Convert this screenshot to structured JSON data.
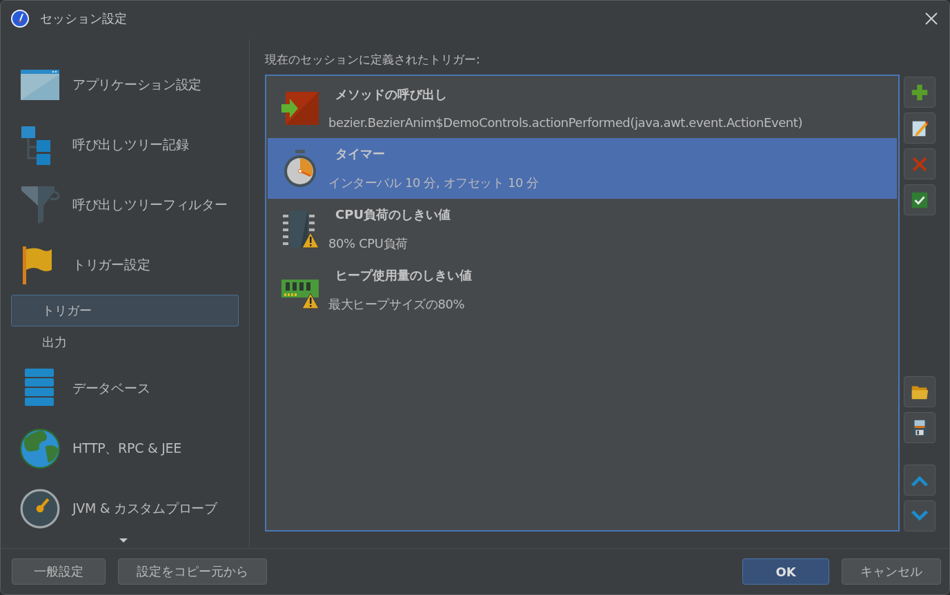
{
  "window": {
    "title": "セッション設定"
  },
  "sidebar": {
    "items": [
      {
        "label": "アプリケーション設定",
        "selected": false
      },
      {
        "label": "呼び出しツリー記録",
        "selected": false
      },
      {
        "label": "呼び出しツリーフィルター",
        "selected": false
      },
      {
        "label": "トリガー設定",
        "selected": false,
        "children": [
          {
            "label": "トリガー",
            "selected": true
          },
          {
            "label": "出力",
            "selected": false
          }
        ]
      },
      {
        "label": "データベース",
        "selected": false
      },
      {
        "label": "HTTP、RPC & JEE",
        "selected": false
      },
      {
        "label": "JVM & カスタムプローブ",
        "selected": false
      }
    ]
  },
  "triggers": {
    "heading": "現在のセッションに定義されたトリガー:",
    "items": [
      {
        "title": "メソッドの呼び出し",
        "detail": "bezier.BezierAnim$DemoControls.actionPerformed(java.awt.event.ActionEvent)",
        "selected": false
      },
      {
        "title": "タイマー",
        "detail": "インターバル 10 分, オフセット 10 分",
        "selected": true
      },
      {
        "title": "CPU負荷のしきい値",
        "detail": "80% CPU負荷",
        "selected": false
      },
      {
        "title": "ヒープ使用量のしきい値",
        "detail": "最大ヒープサイズの80%",
        "selected": false
      }
    ]
  },
  "footer": {
    "left_buttons": [
      {
        "label": "一般設定",
        "default": false
      },
      {
        "label": "設定をコピー元から",
        "default": false
      }
    ],
    "right_buttons": [
      {
        "label": "OK",
        "default": true
      },
      {
        "label": "キャンセル",
        "default": false
      }
    ]
  }
}
